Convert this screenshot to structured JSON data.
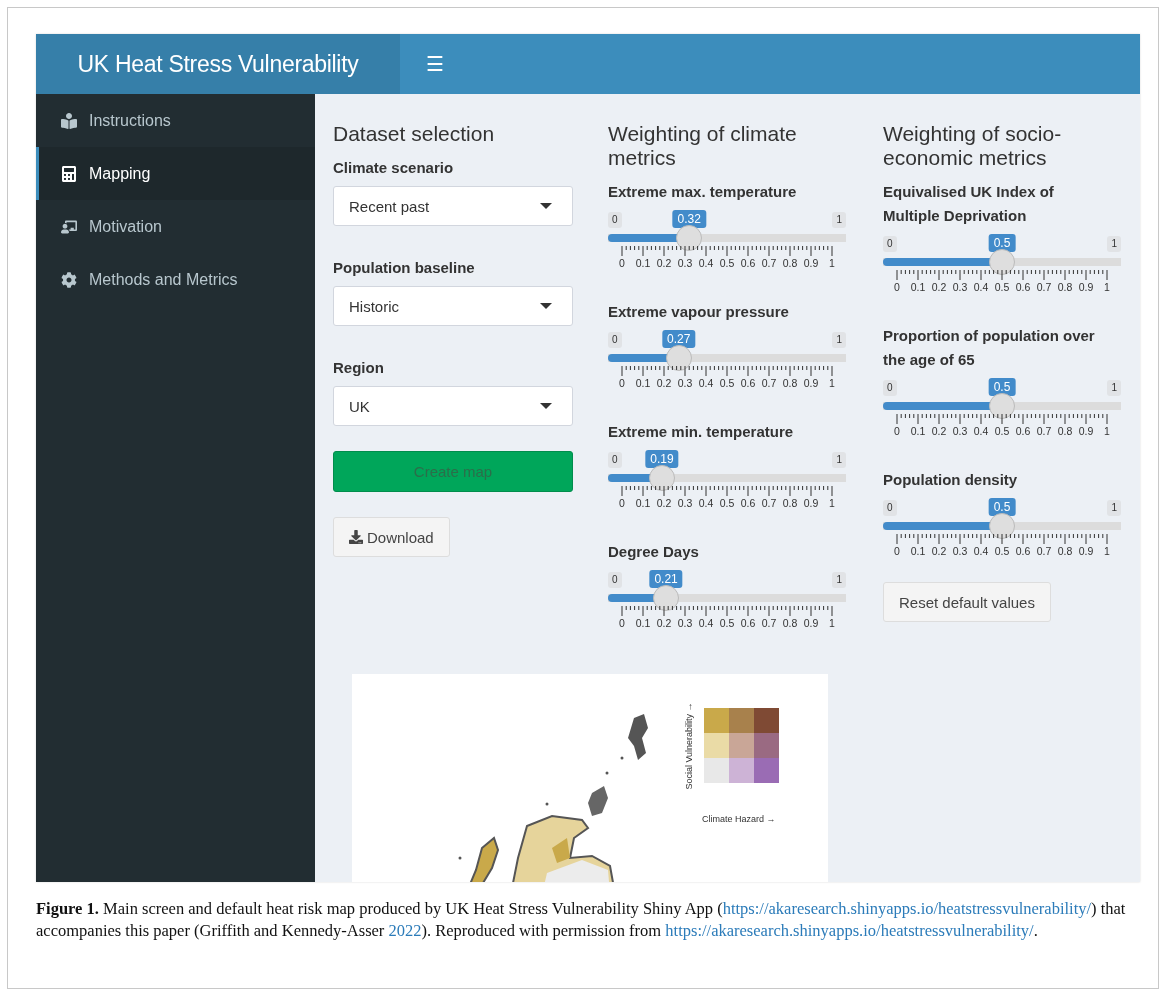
{
  "header": {
    "title": "UK Heat Stress Vulnerability",
    "menu_icon": "☰"
  },
  "sidebar": {
    "items": [
      {
        "label": "Instructions",
        "selected": false
      },
      {
        "label": "Mapping",
        "selected": true
      },
      {
        "label": "Motivation",
        "selected": false
      },
      {
        "label": "Methods and Metrics",
        "selected": false
      }
    ]
  },
  "dataset": {
    "heading": "Dataset selection",
    "selects": [
      {
        "label": "Climate scenario",
        "value": "Recent past"
      },
      {
        "label": "Population baseline",
        "value": "Historic"
      },
      {
        "label": "Region",
        "value": "UK"
      }
    ],
    "create_button": "Create map",
    "download_button": "Download"
  },
  "climate": {
    "heading": "Weighting of climate metrics",
    "sliders": [
      {
        "label": "Extreme max. temperature",
        "min": "0",
        "max": "1",
        "value": "0.32",
        "level": 0.32,
        "ticks": [
          "0",
          "0.1",
          "0.2",
          "0.3",
          "0.4",
          "0.5",
          "0.6",
          "0.7",
          "0.8",
          "0.9",
          "1"
        ]
      },
      {
        "label": "Extreme vapour pressure",
        "min": "0",
        "max": "1",
        "value": "0.27",
        "level": 0.27,
        "ticks": [
          "0",
          "0.1",
          "0.2",
          "0.3",
          "0.4",
          "0.5",
          "0.6",
          "0.7",
          "0.8",
          "0.9",
          "1"
        ]
      },
      {
        "label": "Extreme min. temperature",
        "min": "0",
        "max": "1",
        "value": "0.19",
        "level": 0.19,
        "ticks": [
          "0",
          "0.1",
          "0.2",
          "0.3",
          "0.4",
          "0.5",
          "0.6",
          "0.7",
          "0.8",
          "0.9",
          "1"
        ]
      },
      {
        "label": "Degree Days",
        "min": "0",
        "max": "1",
        "value": "0.21",
        "level": 0.21,
        "ticks": [
          "0",
          "0.1",
          "0.2",
          "0.3",
          "0.4",
          "0.5",
          "0.6",
          "0.7",
          "0.8",
          "0.9",
          "1"
        ]
      }
    ]
  },
  "socio": {
    "heading": "Weighting of socio-economic metrics",
    "sliders": [
      {
        "label": "Equivalised UK Index of Multiple Deprivation",
        "min": "0",
        "max": "1",
        "value": "0.5",
        "level": 0.5,
        "ticks": [
          "0",
          "0.1",
          "0.2",
          "0.3",
          "0.4",
          "0.5",
          "0.6",
          "0.7",
          "0.8",
          "0.9",
          "1"
        ]
      },
      {
        "label": "Proportion of population over the age of 65",
        "min": "0",
        "max": "1",
        "value": "0.5",
        "level": 0.5,
        "ticks": [
          "0",
          "0.1",
          "0.2",
          "0.3",
          "0.4",
          "0.5",
          "0.6",
          "0.7",
          "0.8",
          "0.9",
          "1"
        ]
      },
      {
        "label": "Population density",
        "min": "0",
        "max": "1",
        "value": "0.5",
        "level": 0.5,
        "ticks": [
          "0",
          "0.1",
          "0.2",
          "0.3",
          "0.4",
          "0.5",
          "0.6",
          "0.7",
          "0.8",
          "0.9",
          "1"
        ]
      }
    ],
    "reset_button": "Reset default values"
  },
  "map": {
    "y_axis": "Social Vulnerability →",
    "x_axis": "Climate Hazard →",
    "legend_rows": [
      [
        {
          "color": "#c9a94a"
        },
        {
          "color": "#a8814c"
        },
        {
          "color": "#7f4a34"
        }
      ],
      [
        {
          "color": "#eadba6"
        },
        {
          "color": "#c9a697"
        },
        {
          "color": "#9a6a82"
        }
      ],
      [
        {
          "color": "#e8e8e8"
        },
        {
          "color": "#cdb3d6"
        },
        {
          "color": "#9a6cb4"
        }
      ]
    ]
  },
  "caption": {
    "label": "Figure 1.",
    "segments": [
      {
        "kind": "text",
        "text": " Main screen and default heat risk map produced by UK Heat Stress Vulnerability Shiny App ("
      },
      {
        "kind": "link",
        "text": "https://akaresearch.shinyapps.io/heatstressvulnerability/"
      },
      {
        "kind": "text",
        "text": ") that accompanies this paper (Griffith and Kennedy-Asser "
      },
      {
        "kind": "link",
        "text": "2022"
      },
      {
        "kind": "text",
        "text": "). Reproduced with permission from "
      },
      {
        "kind": "link",
        "text": "https://akaresearch.shinyapps.io/heatstressvulnerability/"
      },
      {
        "kind": "text",
        "text": "."
      }
    ]
  }
}
